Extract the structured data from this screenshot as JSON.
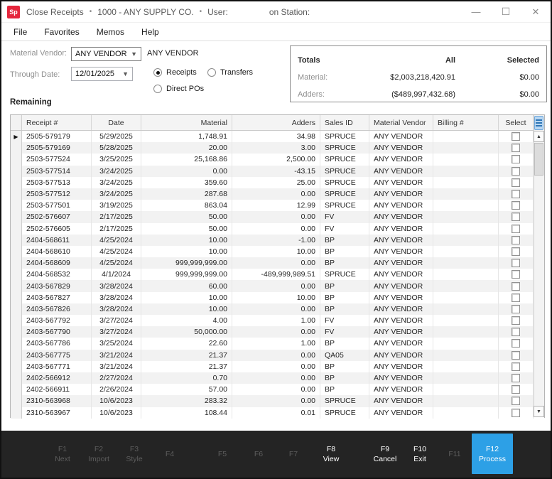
{
  "colors": {
    "accent_blue": "#2da0e6",
    "logo_red": "#e5263c"
  },
  "window": {
    "logo_text": "Sp",
    "app_title": "Close Receipts",
    "separator": "•",
    "company": "1000 - ANY SUPPLY CO.",
    "user_label": "User:",
    "station_label": "on Station:",
    "minimize_glyph": "—",
    "maximize_glyph": "☐",
    "close_glyph": "✕"
  },
  "menu": {
    "items": [
      "File",
      "Favorites",
      "Memos",
      "Help"
    ]
  },
  "filters": {
    "material_vendor_label": "Material Vendor:",
    "material_vendor_value": "ANY VENDOR",
    "material_vendor_desc": "ANY VENDOR",
    "through_date_label": "Through Date:",
    "through_date_value": "12/01/2025",
    "radio_receipts": "Receipts",
    "radio_transfers": "Transfers",
    "radio_direct_pos": "Direct POs",
    "selected_radio": "Receipts"
  },
  "totals": {
    "title": "Totals",
    "col_all": "All",
    "col_selected": "Selected",
    "material_label": "Material:",
    "material_all": "$2,003,218,420.91",
    "material_selected": "$0.00",
    "adders_label": "Adders:",
    "adders_all": "($489,997,432.68)",
    "adders_selected": "$0.00"
  },
  "section_label": "Remaining",
  "grid": {
    "columns": [
      "Receipt #",
      "Date",
      "Material",
      "Adders",
      "Sales ID",
      "Material Vendor",
      "Billing #",
      "Select"
    ],
    "rows": [
      {
        "receipt": "2505-579179",
        "date": "5/29/2025",
        "material": "1,748.91",
        "adders": "34.98",
        "sales_id": "SPRUCE",
        "vendor": "ANY VENDOR",
        "billing": "",
        "selected": false
      },
      {
        "receipt": "2505-579169",
        "date": "5/28/2025",
        "material": "20.00",
        "adders": "3.00",
        "sales_id": "SPRUCE",
        "vendor": "ANY VENDOR",
        "billing": "",
        "selected": false
      },
      {
        "receipt": "2503-577524",
        "date": "3/25/2025",
        "material": "25,168.86",
        "adders": "2,500.00",
        "sales_id": "SPRUCE",
        "vendor": "ANY VENDOR",
        "billing": "",
        "selected": false
      },
      {
        "receipt": "2503-577514",
        "date": "3/24/2025",
        "material": "0.00",
        "adders": "-43.15",
        "sales_id": "SPRUCE",
        "vendor": "ANY VENDOR",
        "billing": "",
        "selected": false
      },
      {
        "receipt": "2503-577513",
        "date": "3/24/2025",
        "material": "359.60",
        "adders": "25.00",
        "sales_id": "SPRUCE",
        "vendor": "ANY VENDOR",
        "billing": "",
        "selected": false
      },
      {
        "receipt": "2503-577512",
        "date": "3/24/2025",
        "material": "287.68",
        "adders": "0.00",
        "sales_id": "SPRUCE",
        "vendor": "ANY VENDOR",
        "billing": "",
        "selected": false
      },
      {
        "receipt": "2503-577501",
        "date": "3/19/2025",
        "material": "863.04",
        "adders": "12.99",
        "sales_id": "SPRUCE",
        "vendor": "ANY VENDOR",
        "billing": "",
        "selected": false
      },
      {
        "receipt": "2502-576607",
        "date": "2/17/2025",
        "material": "50.00",
        "adders": "0.00",
        "sales_id": "FV",
        "vendor": "ANY VENDOR",
        "billing": "",
        "selected": false
      },
      {
        "receipt": "2502-576605",
        "date": "2/17/2025",
        "material": "50.00",
        "adders": "0.00",
        "sales_id": "FV",
        "vendor": "ANY VENDOR",
        "billing": "",
        "selected": false
      },
      {
        "receipt": "2404-568611",
        "date": "4/25/2024",
        "material": "10.00",
        "adders": "-1.00",
        "sales_id": "BP",
        "vendor": "ANY VENDOR",
        "billing": "",
        "selected": false
      },
      {
        "receipt": "2404-568610",
        "date": "4/25/2024",
        "material": "10.00",
        "adders": "10.00",
        "sales_id": "BP",
        "vendor": "ANY VENDOR",
        "billing": "",
        "selected": false
      },
      {
        "receipt": "2404-568609",
        "date": "4/25/2024",
        "material": "999,999,999.00",
        "adders": "0.00",
        "sales_id": "BP",
        "vendor": "ANY VENDOR",
        "billing": "",
        "selected": false
      },
      {
        "receipt": "2404-568532",
        "date": "4/1/2024",
        "material": "999,999,999.00",
        "adders": "-489,999,989.51",
        "sales_id": "SPRUCE",
        "vendor": "ANY VENDOR",
        "billing": "",
        "selected": false
      },
      {
        "receipt": "2403-567829",
        "date": "3/28/2024",
        "material": "60.00",
        "adders": "0.00",
        "sales_id": "BP",
        "vendor": "ANY VENDOR",
        "billing": "",
        "selected": false
      },
      {
        "receipt": "2403-567827",
        "date": "3/28/2024",
        "material": "10.00",
        "adders": "10.00",
        "sales_id": "BP",
        "vendor": "ANY VENDOR",
        "billing": "",
        "selected": false
      },
      {
        "receipt": "2403-567826",
        "date": "3/28/2024",
        "material": "10.00",
        "adders": "0.00",
        "sales_id": "BP",
        "vendor": "ANY VENDOR",
        "billing": "",
        "selected": false
      },
      {
        "receipt": "2403-567792",
        "date": "3/27/2024",
        "material": "4.00",
        "adders": "1.00",
        "sales_id": "FV",
        "vendor": "ANY VENDOR",
        "billing": "",
        "selected": false
      },
      {
        "receipt": "2403-567790",
        "date": "3/27/2024",
        "material": "50,000.00",
        "adders": "0.00",
        "sales_id": "FV",
        "vendor": "ANY VENDOR",
        "billing": "",
        "selected": false
      },
      {
        "receipt": "2403-567786",
        "date": "3/25/2024",
        "material": "22.60",
        "adders": "1.00",
        "sales_id": "BP",
        "vendor": "ANY VENDOR",
        "billing": "",
        "selected": false
      },
      {
        "receipt": "2403-567775",
        "date": "3/21/2024",
        "material": "21.37",
        "adders": "0.00",
        "sales_id": "QA05",
        "vendor": "ANY VENDOR",
        "billing": "",
        "selected": false
      },
      {
        "receipt": "2403-567771",
        "date": "3/21/2024",
        "material": "21.37",
        "adders": "0.00",
        "sales_id": "BP",
        "vendor": "ANY VENDOR",
        "billing": "",
        "selected": false
      },
      {
        "receipt": "2402-566912",
        "date": "2/27/2024",
        "material": "0.70",
        "adders": "0.00",
        "sales_id": "BP",
        "vendor": "ANY VENDOR",
        "billing": "",
        "selected": false
      },
      {
        "receipt": "2402-566911",
        "date": "2/26/2024",
        "material": "57.00",
        "adders": "0.00",
        "sales_id": "BP",
        "vendor": "ANY VENDOR",
        "billing": "",
        "selected": false
      },
      {
        "receipt": "2310-563968",
        "date": "10/6/2023",
        "material": "283.32",
        "adders": "0.00",
        "sales_id": "SPRUCE",
        "vendor": "ANY VENDOR",
        "billing": "",
        "selected": false
      },
      {
        "receipt": "2310-563967",
        "date": "10/6/2023",
        "material": "108.44",
        "adders": "0.01",
        "sales_id": "SPRUCE",
        "vendor": "ANY VENDOR",
        "billing": "",
        "selected": false
      }
    ]
  },
  "footer": {
    "keys": [
      {
        "key": "F1",
        "label": "Next",
        "enabled": false,
        "primary": false
      },
      {
        "key": "F2",
        "label": "Import",
        "enabled": false,
        "primary": false
      },
      {
        "key": "F3",
        "label": "Style",
        "enabled": false,
        "primary": false
      },
      {
        "key": "F4",
        "label": "",
        "enabled": false,
        "primary": false
      },
      {
        "key": "F5",
        "label": "",
        "enabled": false,
        "primary": false
      },
      {
        "key": "F6",
        "label": "",
        "enabled": false,
        "primary": false
      },
      {
        "key": "F7",
        "label": "",
        "enabled": false,
        "primary": false
      },
      {
        "key": "F8",
        "label": "View",
        "enabled": true,
        "primary": false
      },
      {
        "key": "F9",
        "label": "Cancel",
        "enabled": true,
        "primary": false
      },
      {
        "key": "F10",
        "label": "Exit",
        "enabled": true,
        "primary": false
      },
      {
        "key": "F11",
        "label": "",
        "enabled": false,
        "primary": false
      },
      {
        "key": "F12",
        "label": "Process",
        "enabled": true,
        "primary": true
      }
    ]
  }
}
